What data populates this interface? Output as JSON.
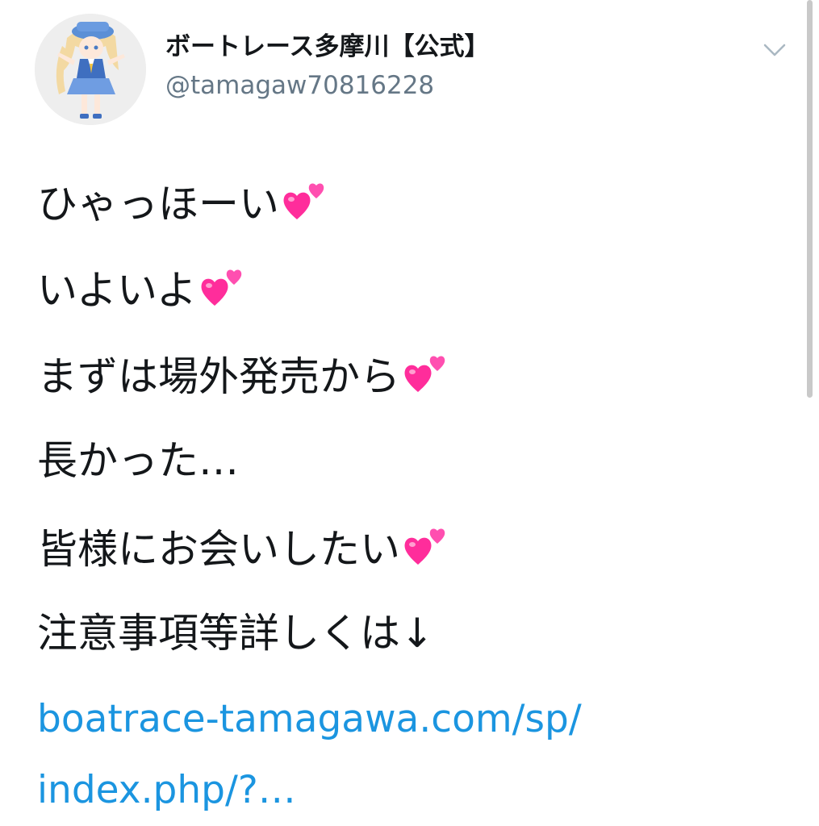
{
  "tweet": {
    "author": {
      "display_name": "ボートレース多摩川【公式】",
      "handle": "@tamagaw70816228",
      "avatar_icon": "mascot-avatar-icon"
    },
    "menu_icon": "chevron-down-icon",
    "lines": [
      {
        "text": "ひゃっほーい",
        "emoji": "two-hearts-icon"
      },
      {
        "text": "いよいよ",
        "emoji": "two-hearts-icon"
      },
      {
        "text": "まずは場外発売から",
        "emoji": "two-hearts-icon"
      },
      {
        "text": "長かった…",
        "emoji": ""
      },
      {
        "text": "皆様にお会いしたい",
        "emoji": "two-hearts-icon"
      },
      {
        "text": "注意事項等詳しくは↓",
        "emoji": ""
      }
    ],
    "link": {
      "line1": "boatrace-tamagawa.com/sp/",
      "line2": "index.php/?…"
    }
  },
  "colors": {
    "text": "#14171a",
    "secondary": "#657786",
    "link": "#1b95e0",
    "heart": "#ff3fa4"
  }
}
